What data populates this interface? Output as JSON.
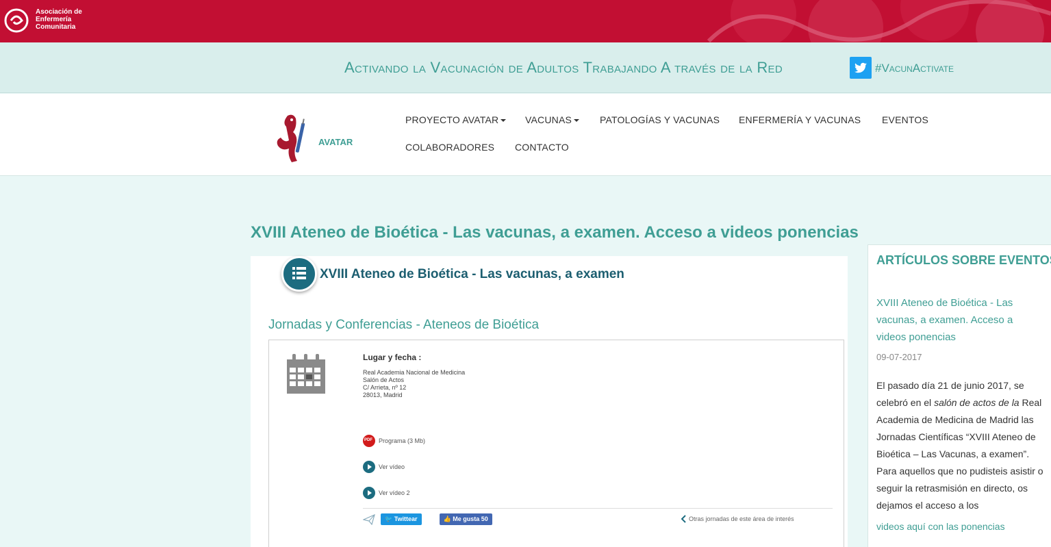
{
  "header": {
    "org_line1": "Asociación de",
    "org_line2": "Enfermería",
    "org_line3": "Comunitaria"
  },
  "banner": {
    "slogan": "Activando la Vacunación de Adultos Trabajando A través de la Red",
    "hashtag": "#VacunActivate"
  },
  "nav": {
    "site_name": "AVATAR",
    "items": [
      {
        "label": "PROYECTO AVATAR",
        "dropdown": true
      },
      {
        "label": "VACUNAS",
        "dropdown": true
      },
      {
        "label": "PATOLOGÍAS Y VACUNAS"
      },
      {
        "label": "ENFERMERÍA Y VACUNAS"
      },
      {
        "label": "EVENTOS"
      },
      {
        "label": "COLABORADORES"
      },
      {
        "label": "CONTACTO"
      }
    ]
  },
  "main": {
    "title": "XVIII Ateneo de Bioética - Las vacunas, a examen. Acceso a videos ponencias",
    "card_title": "XVIII Ateneo de Bioética - Las vacunas, a examen",
    "subtitle": "Jornadas y Conferencias - Ateneos de Bioética",
    "place_label": "Lugar y fecha :",
    "address": [
      "Real Academia Nacional de Medicina",
      "Salón de Actos",
      "C/ Arrieta, nº 12",
      "28013, Madrid"
    ],
    "resources": [
      "Programa (3 Mb)",
      "Ver vídeo",
      "Ver vídeo 2"
    ],
    "tweet_label": "Twittear",
    "like_label": "Me gusta 50",
    "other_link": "Otras jornadas de este área de interés"
  },
  "sidebar": {
    "heading": "ARTÍCULOS SOBRE EVENTOS",
    "article_title": "XVIII Ateneo de Bioética - Las vacunas, a examen. Acceso a videos ponencias",
    "date": "09-07-2017",
    "body_part1": " El pasado día 21 de junio 2017, se celebró en el ",
    "body_italic": "salón de actos de la",
    "body_part2": "  Real Academia de Medicina de Madrid las Jornadas Científicas “XVIII Ateneo de Bioética – Las Vacunas, a examen”. Para aquellos que no pudisteis asistir o seguir la retrasmisión en directo, os dejamos el acceso a los",
    "more_link": "videos aquí con las ponencias"
  },
  "colors": {
    "brand_red": "#c20f33",
    "teal": "#3f9e94",
    "dark_teal": "#1c6c80",
    "twitter": "#1da1f2"
  }
}
